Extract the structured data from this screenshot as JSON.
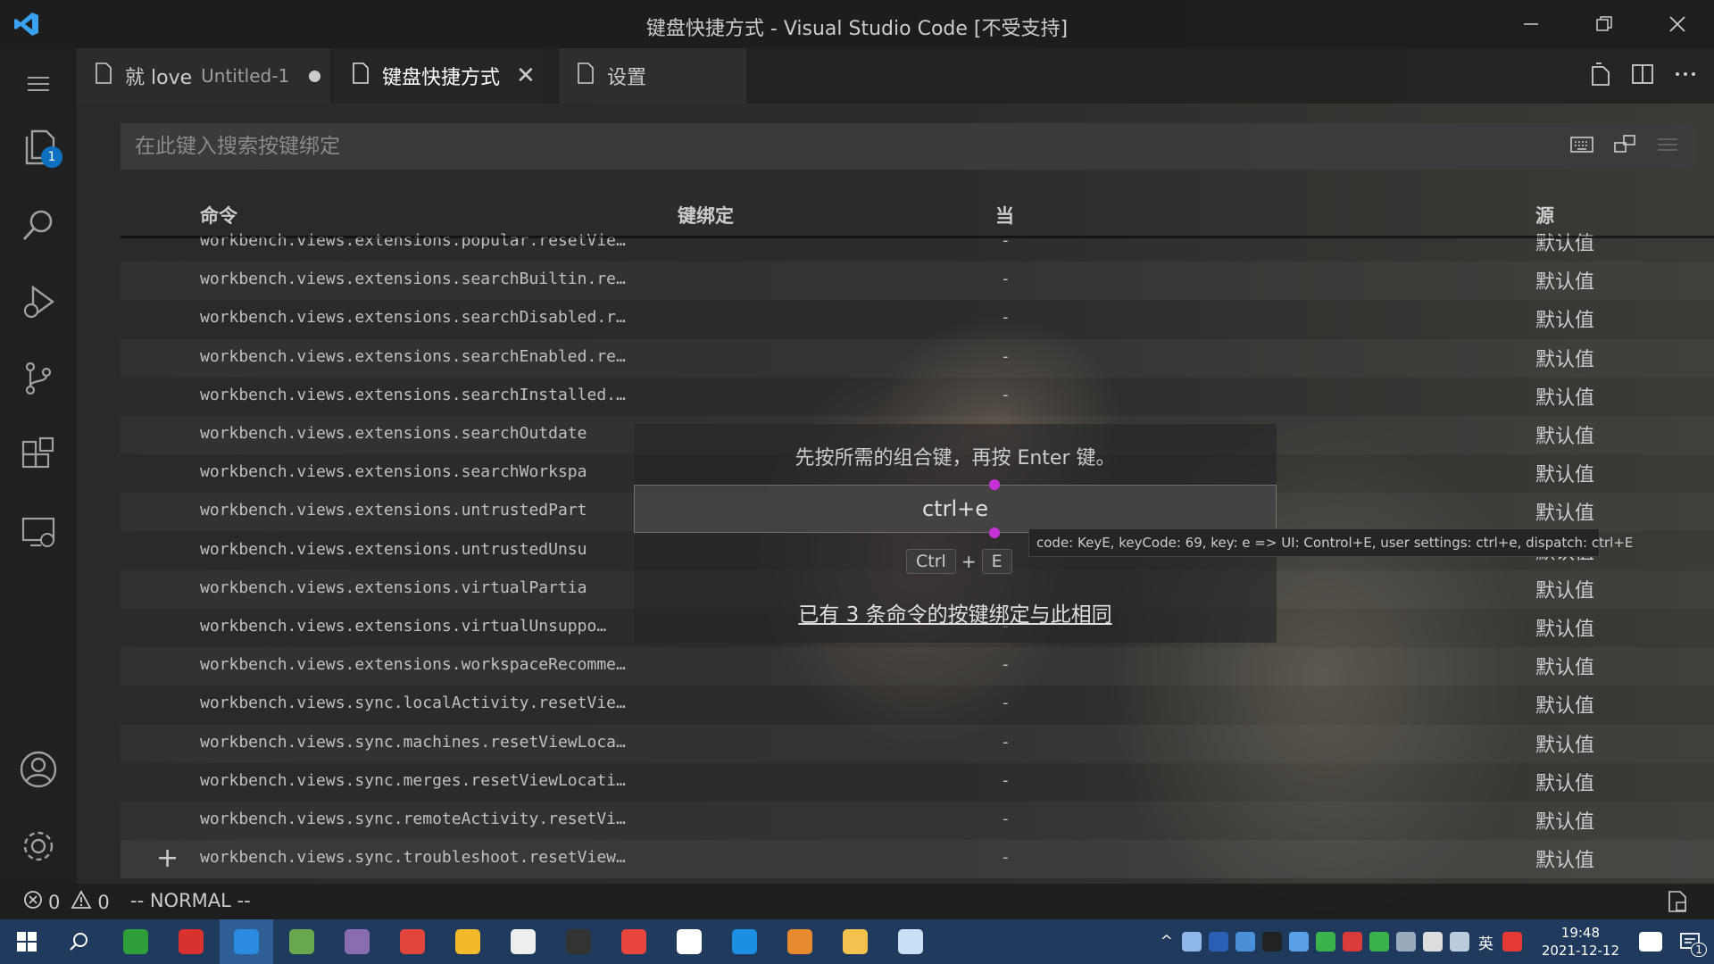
{
  "window": {
    "title": "键盘快捷方式 - Visual Studio Code [不受支持]"
  },
  "activity_bar": {
    "explorer_badge": "1"
  },
  "tabs": [
    {
      "name": "就 love",
      "detail": "Untitled-1",
      "dirty": true
    },
    {
      "name": "键盘快捷方式",
      "active": true
    },
    {
      "name": "设置"
    }
  ],
  "search": {
    "placeholder": "在此键入搜索按键绑定"
  },
  "table": {
    "headers": {
      "command": "命令",
      "keybinding": "键绑定",
      "when": "当",
      "source": "源"
    },
    "rows": [
      {
        "command": "workbench.views.extensions.popular.resetVie…",
        "when": "-",
        "source": "默认值"
      },
      {
        "command": "workbench.views.extensions.searchBuiltin.re…",
        "when": "-",
        "source": "默认值"
      },
      {
        "command": "workbench.views.extensions.searchDisabled.r…",
        "when": "-",
        "source": "默认值"
      },
      {
        "command": "workbench.views.extensions.searchEnabled.re…",
        "when": "-",
        "source": "默认值"
      },
      {
        "command": "workbench.views.extensions.searchInstalled.…",
        "when": "-",
        "source": "默认值"
      },
      {
        "command": "workbench.views.extensions.searchOutdate",
        "when": "",
        "source": "默认值"
      },
      {
        "command": "workbench.views.extensions.searchWorkspa",
        "when": "",
        "source": "默认值"
      },
      {
        "command": "workbench.views.extensions.untrustedPart",
        "when": "",
        "source": "默认值"
      },
      {
        "command": "workbench.views.extensions.untrustedUnsu",
        "when": "",
        "source": "默认值"
      },
      {
        "command": "workbench.views.extensions.virtualPartia",
        "when": "",
        "source": "默认值"
      },
      {
        "command": "workbench.views.extensions.virtualUnsuppo…",
        "when": "-",
        "source": "默认值"
      },
      {
        "command": "workbench.views.extensions.workspaceRecomme…",
        "when": "-",
        "source": "默认值"
      },
      {
        "command": "workbench.views.sync.localActivity.resetVie…",
        "when": "-",
        "source": "默认值"
      },
      {
        "command": "workbench.views.sync.machines.resetViewLoca…",
        "when": "-",
        "source": "默认值"
      },
      {
        "command": "workbench.views.sync.merges.resetViewLocati…",
        "when": "-",
        "source": "默认值"
      },
      {
        "command": "workbench.views.sync.remoteActivity.resetVi…",
        "when": "-",
        "source": "默认值"
      },
      {
        "command": "workbench.views.sync.troubleshoot.resetView…",
        "when": "-",
        "source": "默认值"
      }
    ]
  },
  "keybinding_dialog": {
    "message": "先按所需的组合键，再按 Enter 键。",
    "input_value": "ctrl+e",
    "key1": "Ctrl",
    "plus": "+",
    "key2": "E",
    "conflict_link": "已有 3 条命令的按键绑定与此相同"
  },
  "tooltip": {
    "text": "code: KeyE, keyCode: 69, key: e => UI: Control+E, user settings: ctrl+e, dispatch: ctrl+E"
  },
  "status_bar": {
    "errors": "0",
    "warnings": "0",
    "mode": "-- NORMAL --"
  },
  "taskbar": {
    "ime": "英",
    "time": "19:48",
    "date": "2021-12-12",
    "notification_count": "1",
    "apps": [
      {
        "icon": "sublime-icon",
        "color": "#2e9e3a"
      },
      {
        "icon": "red-swirl-icon",
        "color": "#d8322f"
      },
      {
        "icon": "vscode-icon",
        "color": "#2b8be0"
      },
      {
        "icon": "notepad-icon",
        "color": "#6aa84f"
      },
      {
        "icon": "image-viewer-icon",
        "color": "#8a6db0"
      },
      {
        "icon": "snail-icon",
        "color": "#e0463c"
      },
      {
        "icon": "star-folder-icon",
        "color": "#f2b92d"
      },
      {
        "icon": "panda-icon",
        "color": "#eeeeee"
      },
      {
        "icon": "terminal-icon",
        "color": "#333333"
      },
      {
        "icon": "chrome-icon",
        "color": "#e8453c"
      },
      {
        "icon": "typora-icon",
        "color": "#ffffff"
      },
      {
        "icon": "window-tool-icon",
        "color": "#1d8fe0"
      },
      {
        "icon": "orange-app-icon",
        "color": "#e88a2f"
      },
      {
        "icon": "file-explorer-icon",
        "color": "#f2c14e"
      },
      {
        "icon": "flower-app-icon",
        "color": "#c9dff5"
      }
    ]
  },
  "colors": {
    "accent": "#0e70c0",
    "cursor_marker": "#c531d6",
    "taskbar": "#1f3a5c"
  }
}
